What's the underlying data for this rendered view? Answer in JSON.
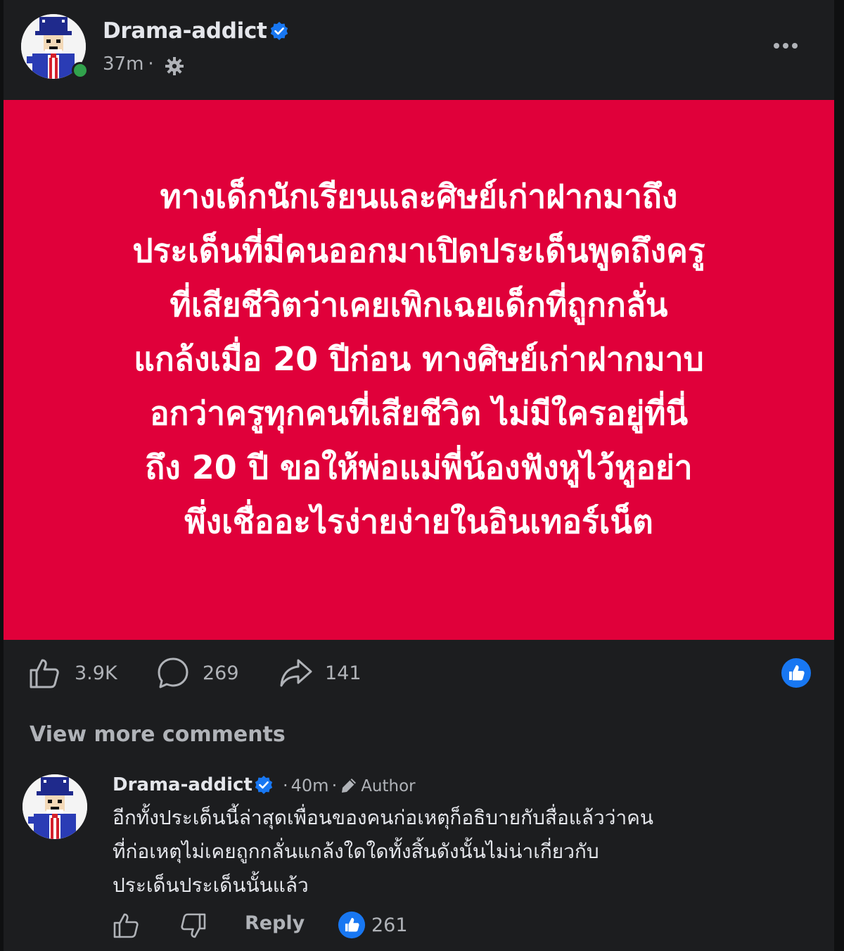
{
  "post": {
    "author": "Drama-addict",
    "time": "37m",
    "separator": "·",
    "text_lines": [
      "ทางเด็กนักเรียนและศิษย์เก่าฝากมาถึง",
      "ประเด็นที่มีคนออกมาเปิดประเด็นพูดถึงครู",
      "ที่เสียชีวิตว่าเคยเพิกเฉยเด็กที่ถูกกลั่น",
      "แกล้งเมื่อ 20 ปีก่อน ทางศิษย์เก่าฝากมาบ",
      "อกว่าครูทุกคนที่เสียชีวิต ไม่มีใครอยู่ที่นี่",
      "ถึง 20 ปี ขอให้พ่อแม่พี่น้องฟังหูไว้หูอย่า",
      "พึ่งเชื่ออะไรง่ายง่ายในอินเทอร์เน็ต"
    ],
    "background_color": "#e0003a",
    "likes": "3.9K",
    "comments": "269",
    "shares": "141"
  },
  "view_more_comments": "View more comments",
  "comment": {
    "author": "Drama-addict",
    "time": "40m",
    "separator": "·",
    "badge": "Author",
    "text_lines": [
      "อีกทั้งประเด็นนี้ล่าสุดเพื่อนของคนก่อเหตุก็อธิบายกับสื่อแล้วว่าคน",
      "ที่ก่อเหตุไม่เคยถูกกลั่นแกล้งใดใดทั้งสิ้นดังนั้นไม่น่าเกี่ยวกับ",
      "ประเด็นประเด็นนั้นแล้ว"
    ],
    "reply_label": "Reply",
    "reaction_count": "261"
  },
  "icons": {
    "verified": "verified-badge-icon",
    "privacy": "gear-icon",
    "more": "more-options-icon",
    "like": "thumbs-up-icon",
    "comment": "comment-bubble-icon",
    "share": "share-arrow-icon",
    "reaction": "like-reaction-icon",
    "dislike": "thumbs-down-icon",
    "author_badge": "pen-icon"
  },
  "colors": {
    "accent": "#1877f2",
    "background": "#1c1d1f",
    "secondary_text": "#b0b3b8",
    "online": "#31a24c"
  }
}
